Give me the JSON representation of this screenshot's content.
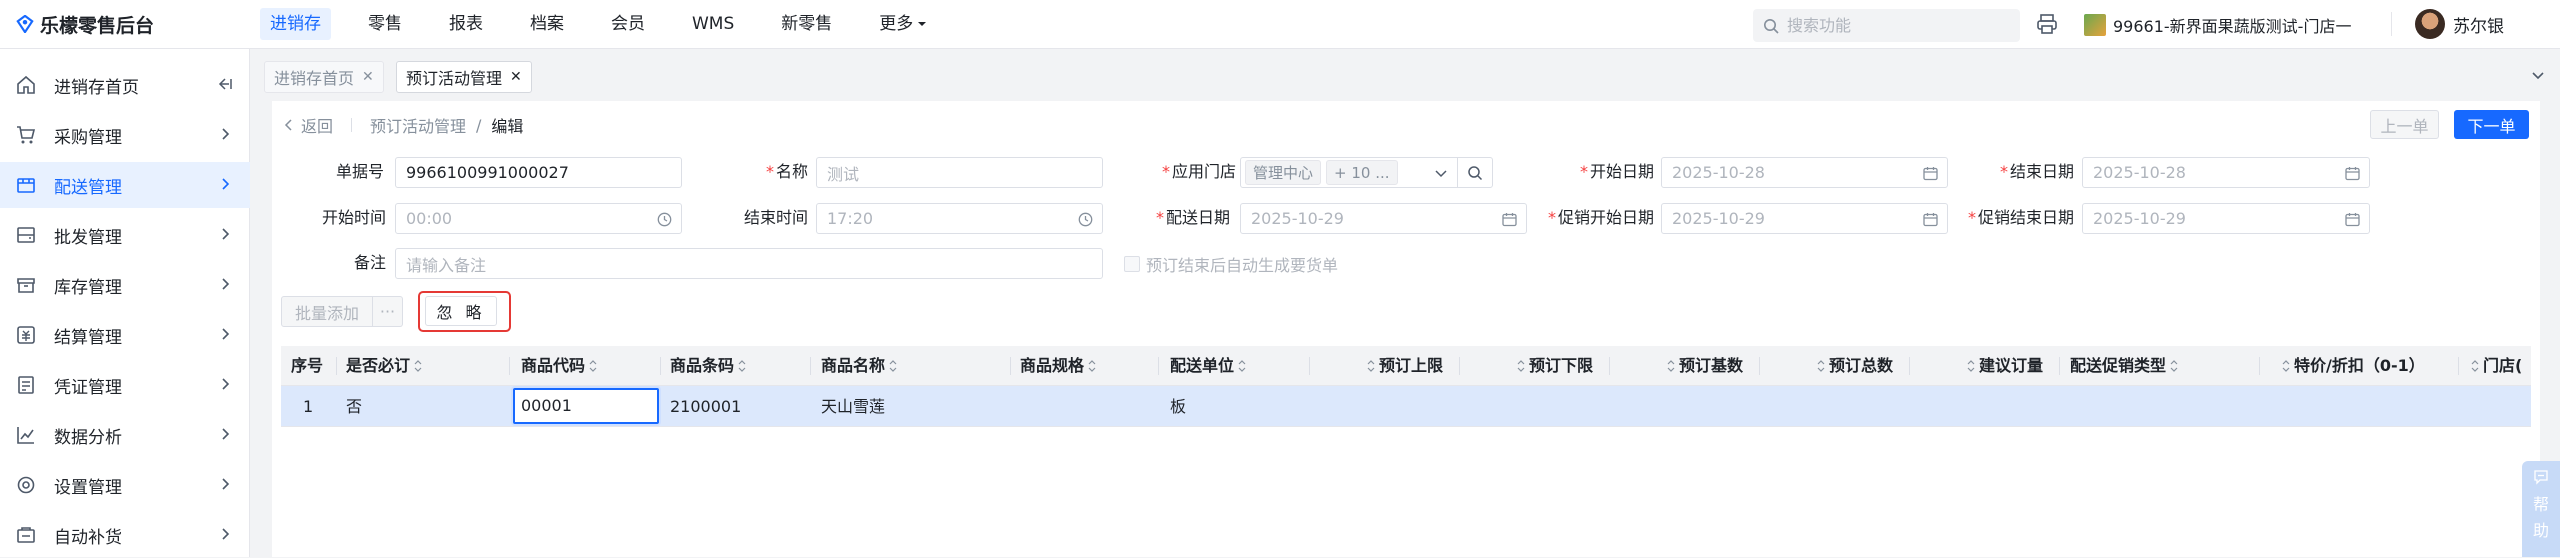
{
  "app": {
    "title": "乐檬零售后台"
  },
  "topnav": [
    {
      "label": "进销存",
      "active": true
    },
    {
      "label": "零售"
    },
    {
      "label": "报表"
    },
    {
      "label": "档案"
    },
    {
      "label": "会员"
    },
    {
      "label": "WMS"
    },
    {
      "label": "新零售"
    },
    {
      "label": "更多"
    }
  ],
  "search": {
    "placeholder": "搜索功能"
  },
  "store": {
    "label": "99661-新界面果蔬版测试-门店一"
  },
  "user": {
    "name": "苏尔银"
  },
  "sidebar": {
    "items": [
      {
        "label": "进销存首页",
        "icon": "home-icon"
      },
      {
        "label": "采购管理",
        "icon": "cart-icon"
      },
      {
        "label": "配送管理",
        "icon": "delivery-icon",
        "active": true
      },
      {
        "label": "批发管理",
        "icon": "wholesale-icon"
      },
      {
        "label": "库存管理",
        "icon": "inventory-icon"
      },
      {
        "label": "结算管理",
        "icon": "settlement-icon"
      },
      {
        "label": "凭证管理",
        "icon": "voucher-icon"
      },
      {
        "label": "数据分析",
        "icon": "chart-icon"
      },
      {
        "label": "设置管理",
        "icon": "settings-icon"
      },
      {
        "label": "自动补货",
        "icon": "replenish-icon"
      }
    ]
  },
  "tabs": [
    {
      "label": "进销存首页"
    },
    {
      "label": "预订活动管理",
      "active": true
    }
  ],
  "breadcrumb": {
    "back": "返回",
    "parent": "预订活动管理",
    "sep": "/",
    "current": "编辑"
  },
  "pager": {
    "prev": "上一单",
    "next": "下一单"
  },
  "form": {
    "order_no": {
      "label": "单据号",
      "value": "9966100991000027"
    },
    "name": {
      "label": "名称",
      "placeholder": "测试"
    },
    "store": {
      "label": "应用门店",
      "chip1": "管理中心",
      "chip2": "+ 10 ..."
    },
    "start_date": {
      "label": "开始日期",
      "value": "2025-10-28"
    },
    "end_date": {
      "label": "结束日期",
      "value": "2025-10-28"
    },
    "start_time": {
      "label": "开始时间",
      "value": "00:00"
    },
    "end_time": {
      "label": "结束时间",
      "value": "17:20"
    },
    "delivery_date": {
      "label": "配送日期",
      "value": "2025-10-29"
    },
    "promo_start": {
      "label": "促销开始日期",
      "value": "2025-10-29"
    },
    "promo_end": {
      "label": "促销结束日期",
      "value": "2025-10-29"
    },
    "remark": {
      "label": "备注",
      "placeholder": "请输入备注"
    },
    "auto_gen": {
      "label": "预订结束后自动生成要货单"
    }
  },
  "toolbar": {
    "batch_add": "批量添加",
    "more": "···",
    "ignore": "忽 略"
  },
  "grid": {
    "headers": [
      "序号",
      "是否必订",
      "商品代码",
      "商品条码",
      "商品名称",
      "商品规格",
      "配送单位",
      "预订上限",
      "预订下限",
      "预订基数",
      "预订总数",
      "建议订量",
      "配送促销类型",
      "特价/折扣（0-1）",
      "门店("
    ],
    "row": {
      "seq": "1",
      "required": "否",
      "code": "00001",
      "barcode": "2100001",
      "name": "天山雪莲",
      "spec": "",
      "unit": "板"
    }
  },
  "help": {
    "label1": "帮",
    "label2": "助"
  }
}
